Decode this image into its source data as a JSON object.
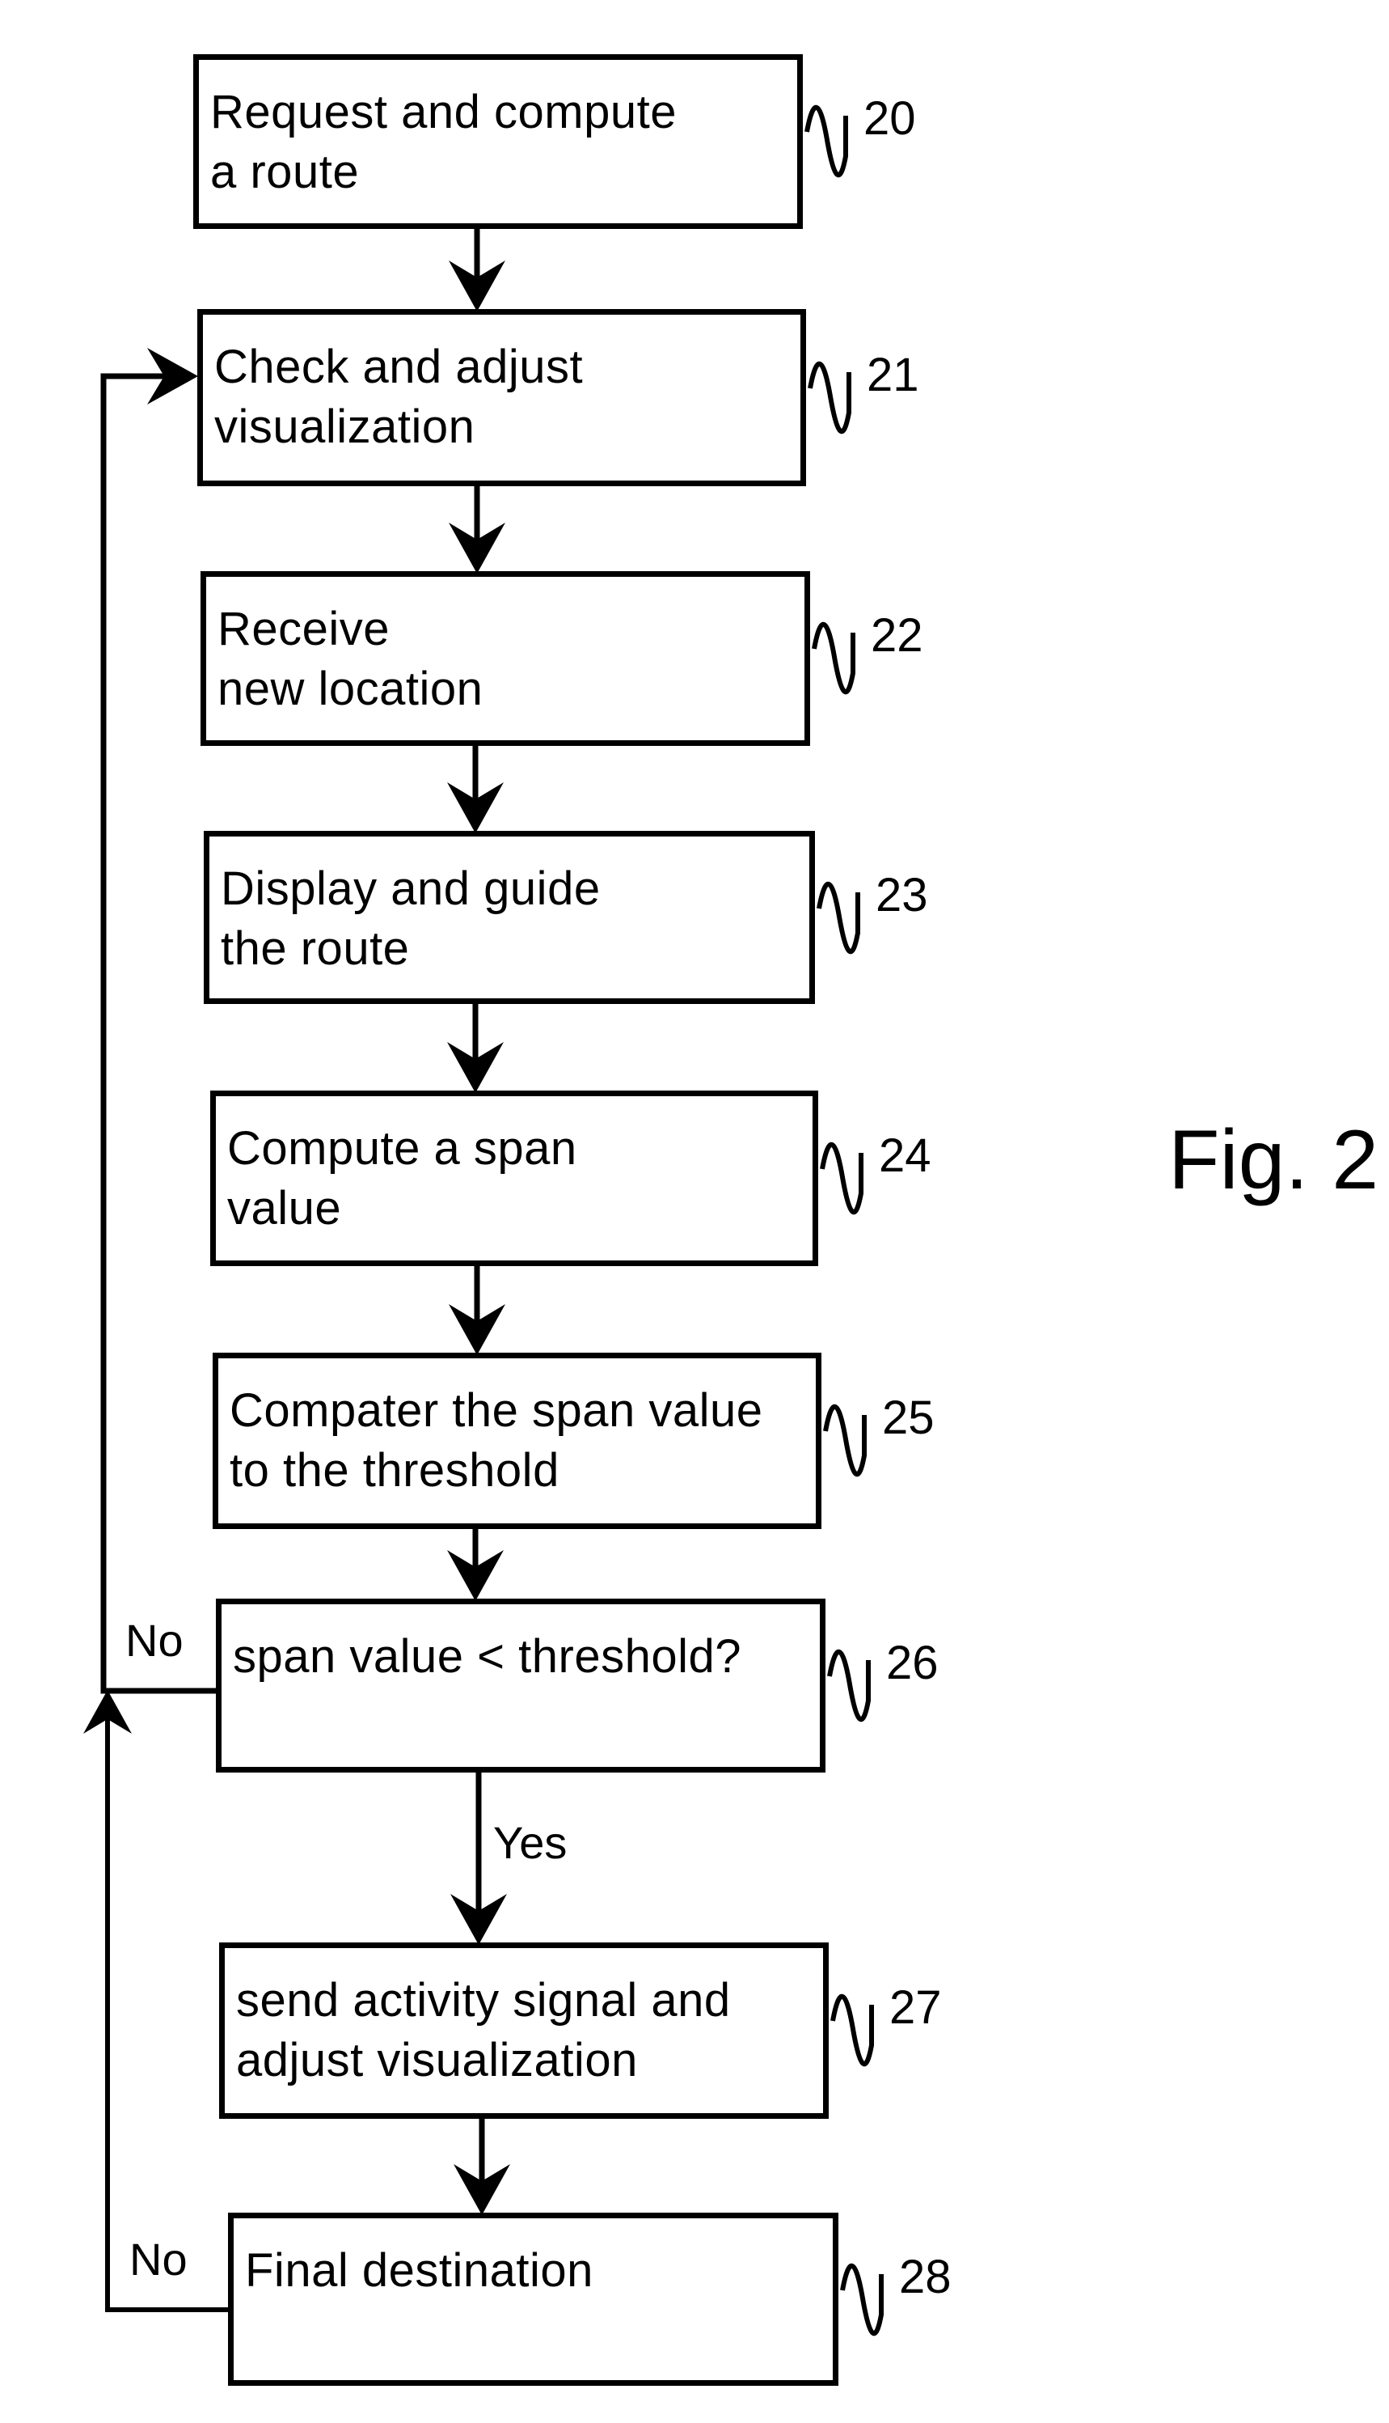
{
  "figure_label": "Fig. 2",
  "steps": [
    {
      "ref": "20",
      "text": "Request and compute\na route"
    },
    {
      "ref": "21",
      "text": "Check and adjust\nvisualization"
    },
    {
      "ref": "22",
      "text": "Receive\nnew location"
    },
    {
      "ref": "23",
      "text": "Display and guide\nthe route"
    },
    {
      "ref": "24",
      "text": "Compute a span\nvalue"
    },
    {
      "ref": "25",
      "text": "Compater the span value\nto the threshold"
    },
    {
      "ref": "26",
      "text": "span value < threshold?"
    },
    {
      "ref": "27",
      "text": "send activity signal and\nadjust visualization"
    },
    {
      "ref": "28",
      "text": "Final destination"
    }
  ],
  "branch_labels": {
    "no_26": "No",
    "yes_26": "Yes",
    "no_28": "No"
  }
}
